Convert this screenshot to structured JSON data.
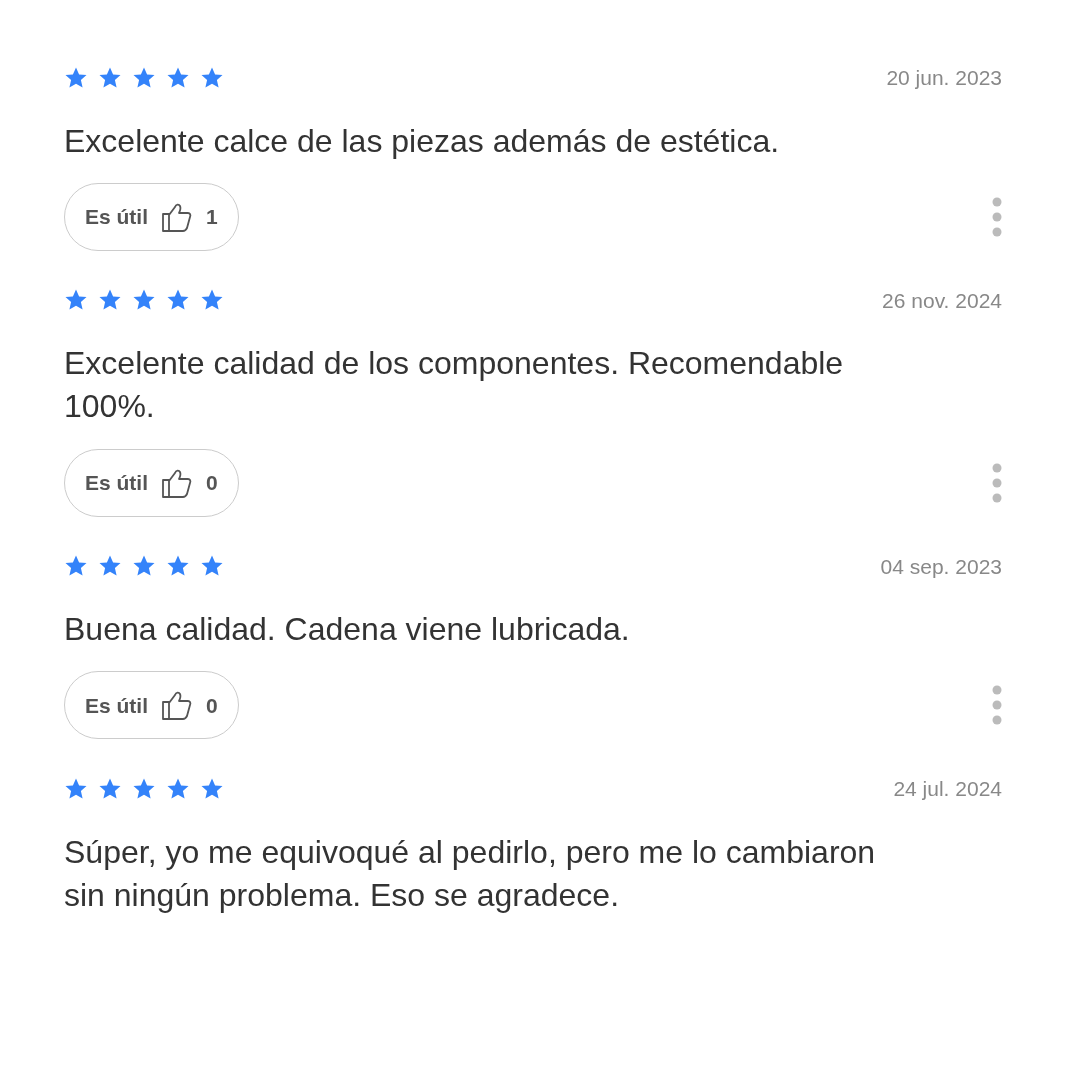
{
  "reviews": [
    {
      "stars": 5,
      "date": "20 jun. 2023",
      "text": "Excelente calce de las piezas además de estética.",
      "helpful": {
        "label": "Es útil",
        "count": "1"
      }
    },
    {
      "stars": 5,
      "date": "26 nov. 2024",
      "text": "Excelente calidad de los componentes. Recomendable 100%.",
      "helpful": {
        "label": "Es útil",
        "count": "0"
      }
    },
    {
      "stars": 5,
      "date": "04 sep. 2023",
      "text": "Buena calidad. Cadena viene lubricada.",
      "helpful": {
        "label": "Es útil",
        "count": "0"
      }
    },
    {
      "stars": 5,
      "date": "24 jul. 2024",
      "text": "Súper, yo me equivoqué al pedirlo, pero me lo cambiaron sin ningún problema. Eso se agradece."
    }
  ]
}
